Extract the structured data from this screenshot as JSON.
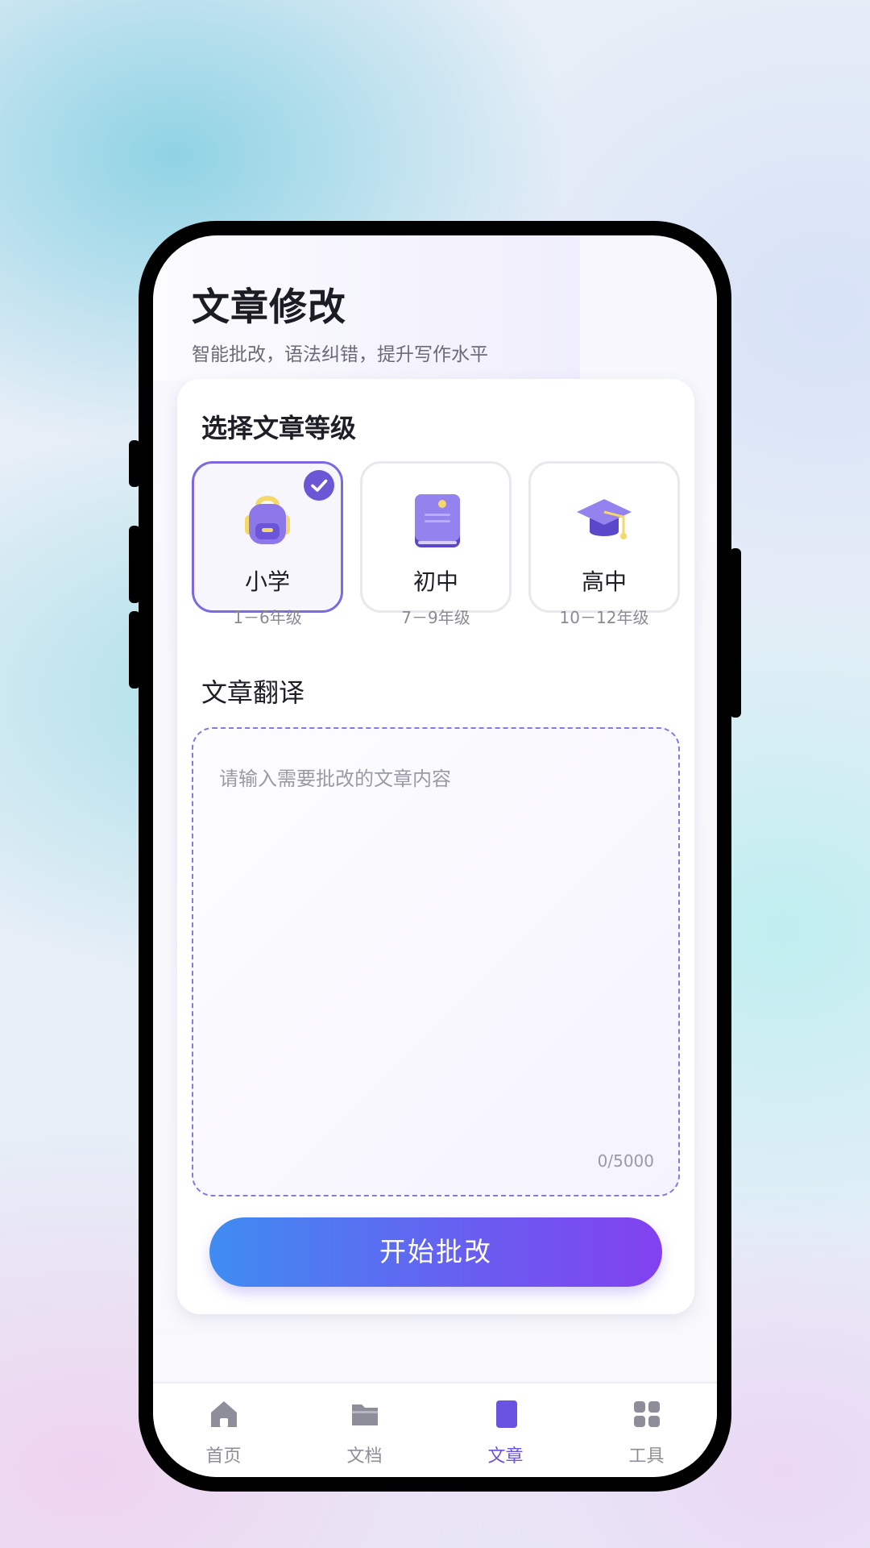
{
  "header": {
    "title": "文章修改",
    "subtitle": "智能批改，语法纠错，提升写作水平"
  },
  "level_section": {
    "title": "选择文章等级",
    "levels": [
      {
        "name": "小学",
        "grade": "1－6年级",
        "selected": true,
        "icon": "backpack-icon"
      },
      {
        "name": "初中",
        "grade": "7－9年级",
        "selected": false,
        "icon": "book-icon"
      },
      {
        "name": "高中",
        "grade": "10－12年级",
        "selected": false,
        "icon": "graduation-cap-icon"
      }
    ]
  },
  "article_section": {
    "title": "文章翻译",
    "placeholder": "请输入需要批改的文章内容",
    "counter": "0/5000"
  },
  "submit_button": "开始批改",
  "tabbar": {
    "items": [
      {
        "label": "首页",
        "icon": "home-icon",
        "active": false
      },
      {
        "label": "文档",
        "icon": "folder-icon",
        "active": false
      },
      {
        "label": "文章",
        "icon": "article-icon",
        "active": true
      },
      {
        "label": "工具",
        "icon": "grid-icon",
        "active": false
      }
    ]
  },
  "colors": {
    "accent": "#6a53e0",
    "selected_border": "#7d68e2",
    "button_start": "#3f8cf2",
    "button_end": "#8241ef",
    "icon_yellow": "#f5d86a"
  }
}
